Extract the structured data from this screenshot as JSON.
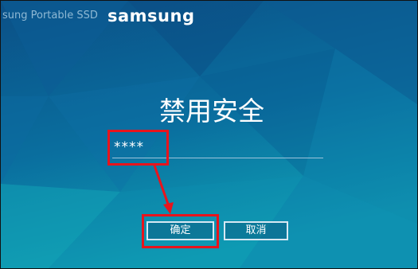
{
  "header": {
    "app_name": "sung Portable SSD",
    "brand_logo": "samsung"
  },
  "dialog": {
    "title": "禁用安全",
    "password_value": "****",
    "confirm_label": "确定",
    "cancel_label": "取消"
  },
  "colors": {
    "background_top": "#0b4f86",
    "background_bottom": "#0fa0b4",
    "highlight": "#e8141c"
  }
}
